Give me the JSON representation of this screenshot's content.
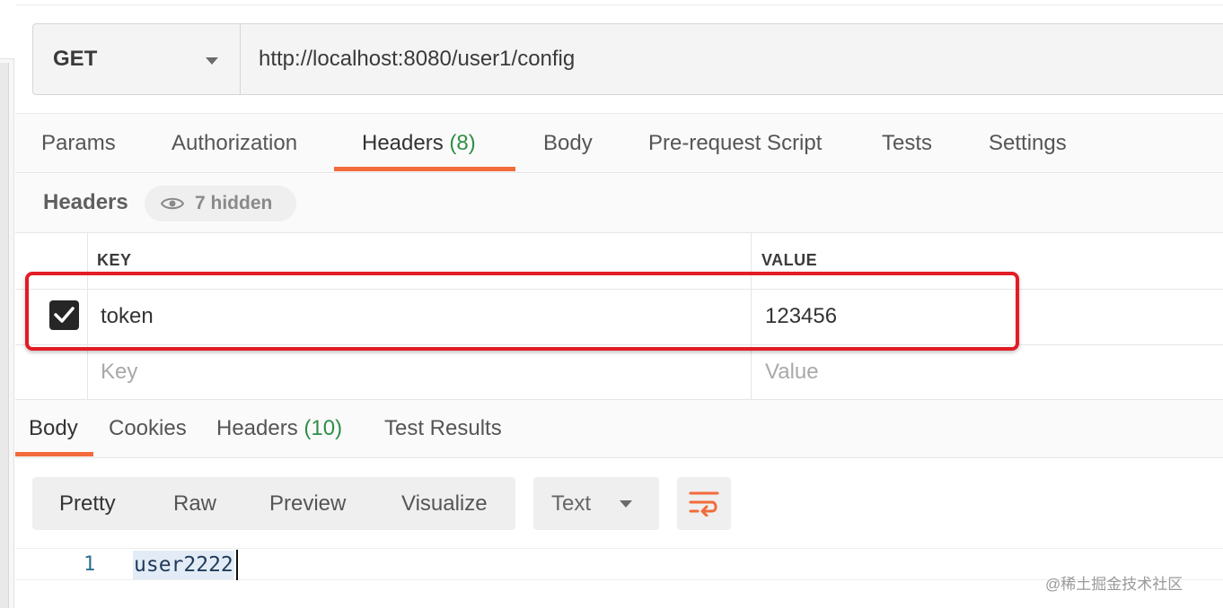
{
  "request": {
    "method": "GET",
    "url": "http://localhost:8080/user1/config"
  },
  "request_tabs": [
    {
      "label": "Params"
    },
    {
      "label": "Authorization"
    },
    {
      "label": "Headers",
      "count": "(8)",
      "active": true
    },
    {
      "label": "Body"
    },
    {
      "label": "Pre-request Script"
    },
    {
      "label": "Tests"
    },
    {
      "label": "Settings"
    }
  ],
  "headers_section": {
    "title": "Headers",
    "hidden_label": "7 hidden"
  },
  "headers_table": {
    "key_header": "KEY",
    "value_header": "VALUE",
    "rows": [
      {
        "enabled": true,
        "key": "token",
        "value": "123456"
      }
    ],
    "new_row": {
      "key_placeholder": "Key",
      "value_placeholder": "Value"
    }
  },
  "response_tabs": [
    {
      "label": "Body",
      "active": true
    },
    {
      "label": "Cookies"
    },
    {
      "label": "Headers",
      "count": "(10)"
    },
    {
      "label": "Test Results"
    }
  ],
  "body_toolbar": {
    "views": [
      "Pretty",
      "Raw",
      "Preview",
      "Visualize"
    ],
    "active_view": "Pretty",
    "format": "Text",
    "wrap_icon": "wrap-lines-icon"
  },
  "response_body": {
    "lines": [
      {
        "number": "1",
        "text": "user2222"
      }
    ]
  },
  "watermark": "@稀土掘金技术社区",
  "colors": {
    "accent": "#f26b3a",
    "count_green": "#2f8f46",
    "highlight_red": "#e31c25"
  }
}
